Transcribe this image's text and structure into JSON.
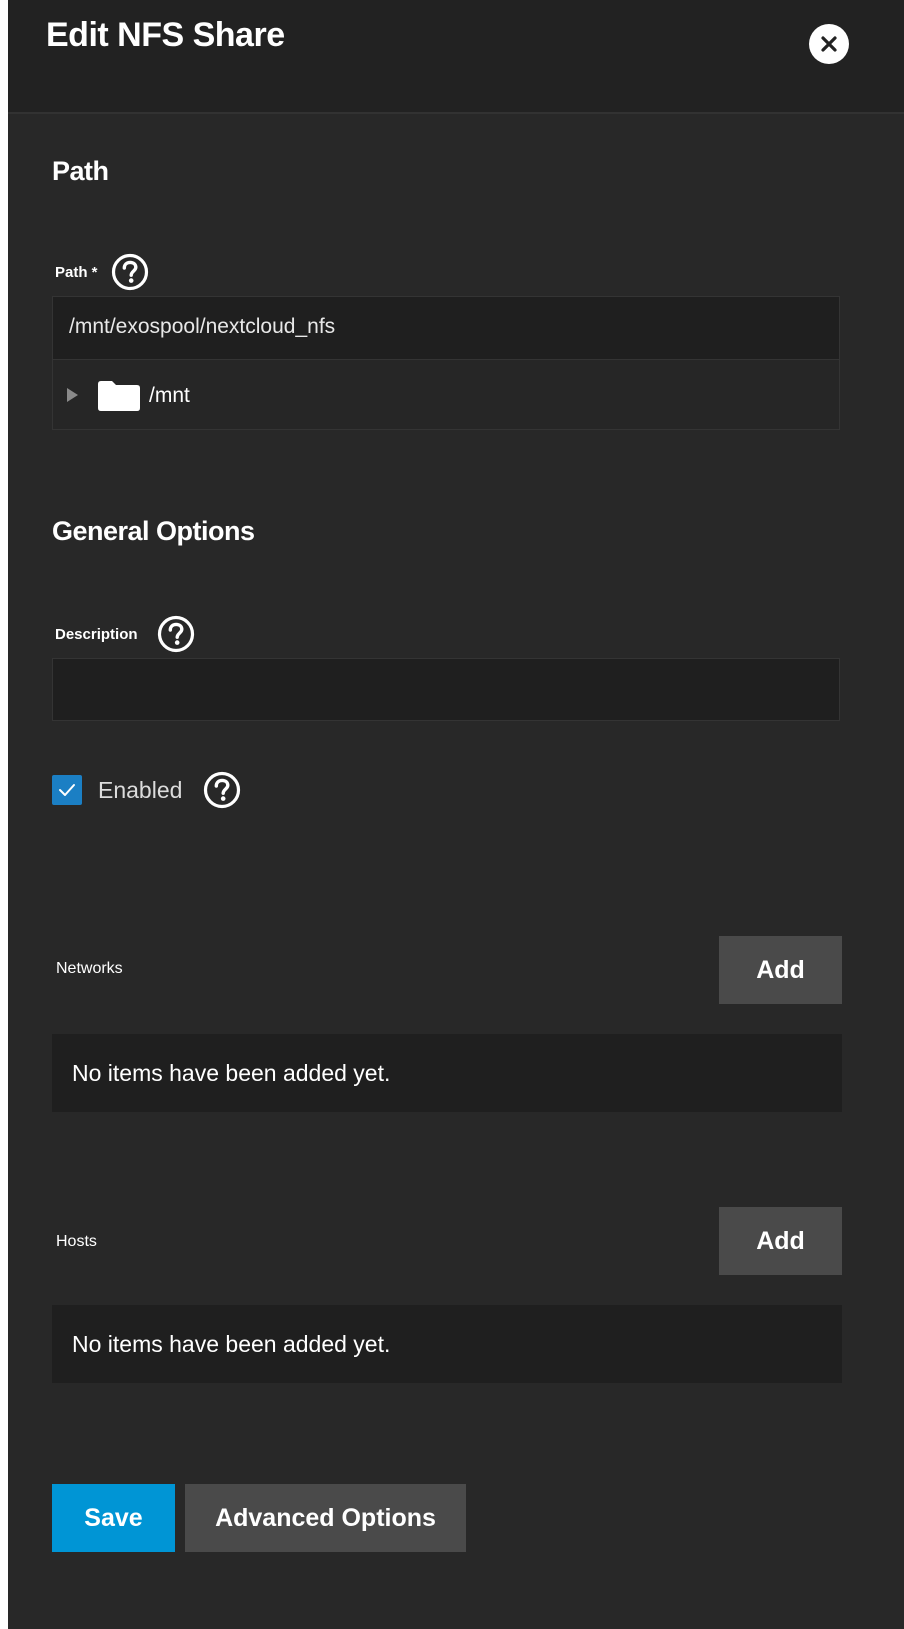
{
  "header": {
    "title": "Edit NFS Share"
  },
  "path_section": {
    "title": "Path",
    "label": "Path *",
    "value": "/mnt/exospool/nextcloud_nfs",
    "tree_root": "/mnt"
  },
  "general_section": {
    "title": "General Options",
    "description_label": "Description",
    "description_value": "",
    "enabled_label": "Enabled",
    "enabled_checked": true
  },
  "networks": {
    "label": "Networks",
    "add_label": "Add",
    "empty_text": "No items have been added yet."
  },
  "hosts": {
    "label": "Hosts",
    "add_label": "Add",
    "empty_text": "No items have been added yet."
  },
  "footer": {
    "save_label": "Save",
    "advanced_label": "Advanced Options"
  },
  "colors": {
    "primary": "#0095d5",
    "checkbox": "#1b7fc4",
    "panel_bg": "#282828",
    "input_bg": "#1f1f1f",
    "secondary_button": "#4a4a4a"
  },
  "icons": {
    "close": "close-circle-icon",
    "help": "help-circle-icon",
    "folder": "folder-icon",
    "tree_toggle": "triangle-right-icon",
    "check": "check-icon"
  }
}
